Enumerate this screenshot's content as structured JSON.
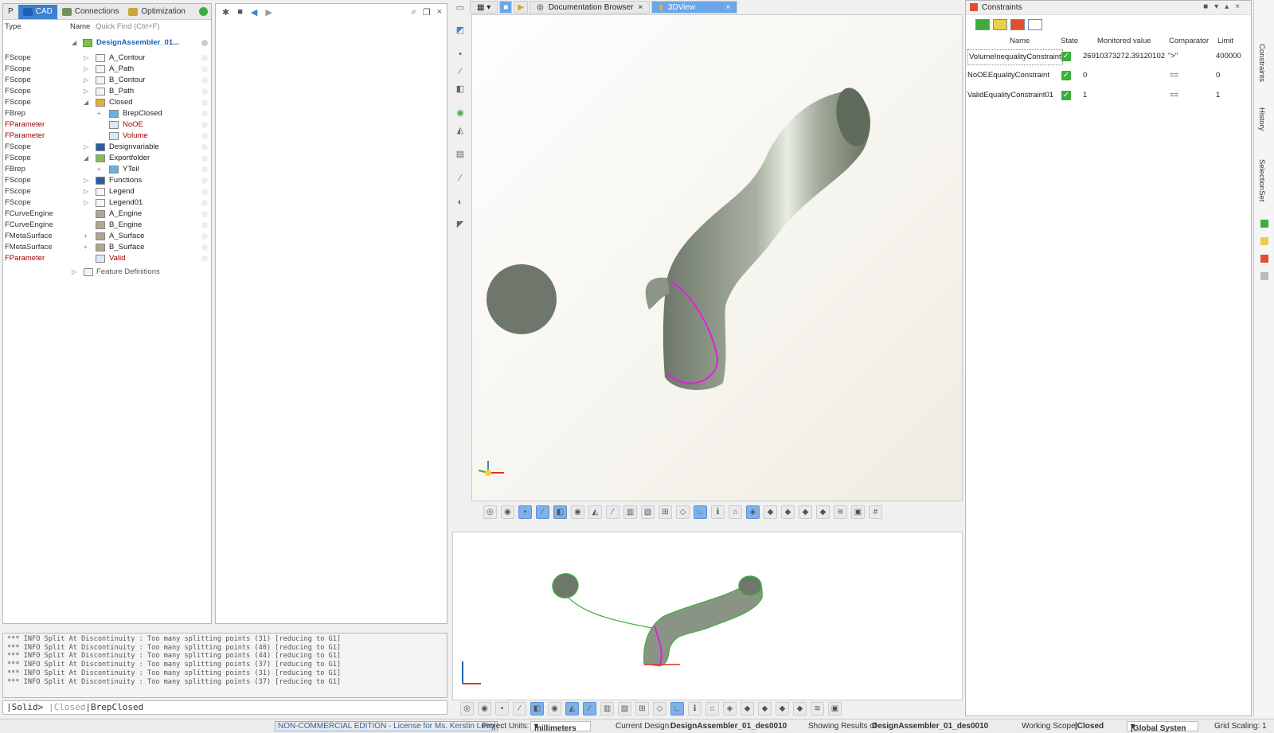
{
  "left_tabs": [
    {
      "label": "P"
    },
    {
      "label": "CAD"
    },
    {
      "label": "Connections"
    },
    {
      "label": "Optimization"
    }
  ],
  "tree_header": {
    "type": "Type",
    "name": "Name",
    "quick_find": "Quick Find (Ctrl+F)"
  },
  "tree_root": "DesignAssembler_01...",
  "tree": [
    {
      "type": "FScope",
      "name": "A_Contour"
    },
    {
      "type": "FScope",
      "name": "A_Path"
    },
    {
      "type": "FScope",
      "name": "B_Contour"
    },
    {
      "type": "FScope",
      "name": "B_Path"
    },
    {
      "type": "FScope",
      "name": "Closed"
    },
    {
      "type": "FBrep",
      "name": "BrepClosed"
    },
    {
      "type": "FParameter",
      "name": "NoOE"
    },
    {
      "type": "FParameter",
      "name": "Volume"
    },
    {
      "type": "FScope",
      "name": "Designvariable"
    },
    {
      "type": "FScope",
      "name": "Exportfolder"
    },
    {
      "type": "FBrep",
      "name": "YTeil"
    },
    {
      "type": "FScope",
      "name": "Functions"
    },
    {
      "type": "FScope",
      "name": "Legend"
    },
    {
      "type": "FScope",
      "name": "Legend01"
    },
    {
      "type": "FCurveEngine",
      "name": "A_Engine"
    },
    {
      "type": "FCurveEngine",
      "name": "B_Engine"
    },
    {
      "type": "FMetaSurface",
      "name": "A_Surface"
    },
    {
      "type": "FMetaSurface",
      "name": "B_Surface"
    },
    {
      "type": "FParameter",
      "name": "Valid"
    }
  ],
  "feature_definitions": "Feature Definitions",
  "console_lines": [
    "*** INFO Split At Discontinuity : Too many splitting points (31) [reducing to G1]",
    "*** INFO Split At Discontinuity : Too many splitting points (40) [reducing to G1]",
    "*** INFO Split At Discontinuity : Too many splitting points (44) [reducing to G1]",
    "*** INFO Split At Discontinuity : Too many splitting points (37) [reducing to G1]",
    "*** INFO Split At Discontinuity : Too many splitting points (31) [reducing to G1]",
    "*** INFO Split At Discontinuity : Too many splitting points (37) [reducing to G1]"
  ],
  "cmdline": {
    "prefix": "|Solid>",
    "path1": " |Closed",
    "path2": "|BrepClosed"
  },
  "viewport_tabs": [
    {
      "label": "Documentation Browser"
    },
    {
      "label": "3DView"
    }
  ],
  "constraints": {
    "title": "Constraints",
    "columns": [
      "Name",
      "State",
      "Monitored value",
      "Comparator",
      "Limit"
    ],
    "rows": [
      {
        "name": "VolumeInequalityConstraint",
        "state": "✓",
        "value": "26910373272.39120102",
        "comparator": "\">\"",
        "limit": "400000"
      },
      {
        "name": "NoOEEqualityConstraint",
        "state": "✓",
        "value": "0",
        "comparator": "==",
        "limit": "0"
      },
      {
        "name": "ValidEqualityConstraint01",
        "state": "✓",
        "value": "1",
        "comparator": "==",
        "limit": "1"
      }
    ]
  },
  "right_strip": [
    "Constraints",
    "History",
    "SelectionSet"
  ],
  "statusbar": {
    "license": "NON-COMMERCIAL EDITION - License for Ms. Kerstin Lorry",
    "units_label": "Project Units:",
    "units_value": "millimeters",
    "design_label": "Current Design:",
    "design_value": "DesignAssembler_01_des0010",
    "results_label": "Showing Results of",
    "results_value": "DesignAssembler_01_des0010",
    "scope_label": "Working Scope:",
    "scope_value": "|Closed",
    "system_value": "|Global Systen",
    "grid_label": "Grid Scaling: 1"
  },
  "colors": {
    "accent": "#3f7fcf",
    "check": "#3dad3d",
    "param": "#a00000",
    "highlight": "#e020e0"
  }
}
